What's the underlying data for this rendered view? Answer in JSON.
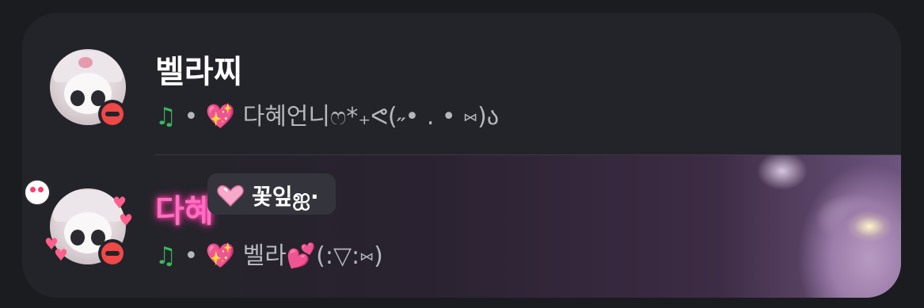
{
  "users": [
    {
      "name": "벨라찌",
      "status": "do-not-disturb",
      "activity": {
        "icon": "music-note-icon",
        "separator": "•",
        "emoji": "sparkling-heart-icon",
        "text": "다혜언니ෆ*₊ᕙ(˶• . • ⑅)ა"
      }
    },
    {
      "name": "다혜",
      "status": "do-not-disturb",
      "tag": {
        "icon": "pink-heart-icon",
        "text": "꽃잎ஐ·"
      },
      "activity": {
        "icon": "music-note-icon",
        "separator": "•",
        "emoji": "sparkling-heart-icon",
        "text_main": "벨라",
        "text_tail": "(:▽:⑅)"
      }
    }
  ],
  "colors": {
    "background": "#1b1c20",
    "panel": "#232429",
    "dnd": "#f04747",
    "music": "#3bb85e",
    "pink_name": "#ff6fc0"
  }
}
